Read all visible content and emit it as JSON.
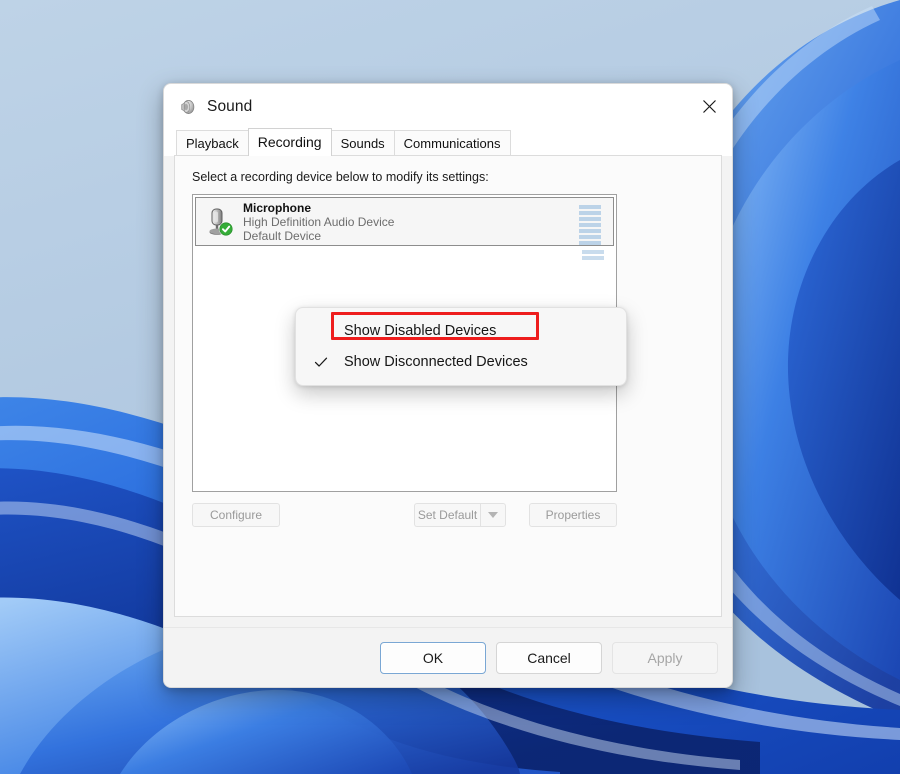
{
  "desktop": {
    "wallpaper_name": "windows-11-bloom-wallpaper",
    "colors": {
      "sky": "#b6cde4",
      "bloom_light": "#5b9ae8",
      "bloom_mid": "#2f6fdc",
      "bloom_deep": "#1442b8",
      "bloom_dark": "#0e2f93"
    }
  },
  "dialog": {
    "title": "Sound",
    "title_icon": "speaker-icon",
    "close_icon": "close-icon",
    "tabs": [
      {
        "label": "Playback",
        "active": false
      },
      {
        "label": "Recording",
        "active": true
      },
      {
        "label": "Sounds",
        "active": false
      },
      {
        "label": "Communications",
        "active": false
      }
    ],
    "page_hint": "Select a recording device below to modify its settings:",
    "devices": [
      {
        "icon": "microphone-icon",
        "badge_icon": "green-check-badge-icon",
        "name": "Microphone",
        "driver": "High Definition Audio Device",
        "status": "Default Device",
        "selected": true,
        "meter_segments": 9,
        "meter_lit": 7
      }
    ],
    "list_buttons": [
      {
        "label": "Configure",
        "name": "configure-button",
        "disabled": true
      },
      {
        "label": "Set Default",
        "name": "set-default-button",
        "disabled": true
      },
      {
        "label": "",
        "name": "set-default-dropdown-button",
        "disabled": true,
        "icon": "chevron-down-icon"
      },
      {
        "label": "Properties",
        "name": "properties-button",
        "disabled": true
      }
    ],
    "footer_buttons": [
      {
        "label": "OK",
        "name": "ok-button",
        "style": "default"
      },
      {
        "label": "Cancel",
        "name": "cancel-button",
        "style": "normal"
      },
      {
        "label": "Apply",
        "name": "apply-button",
        "style": "disabled"
      }
    ]
  },
  "context_menu": {
    "items": [
      {
        "label": "Show Disabled Devices",
        "checked": false,
        "highlighted": true
      },
      {
        "label": "Show Disconnected Devices",
        "checked": true,
        "highlighted": false
      }
    ],
    "highlight_color": "#ee1d1d"
  }
}
